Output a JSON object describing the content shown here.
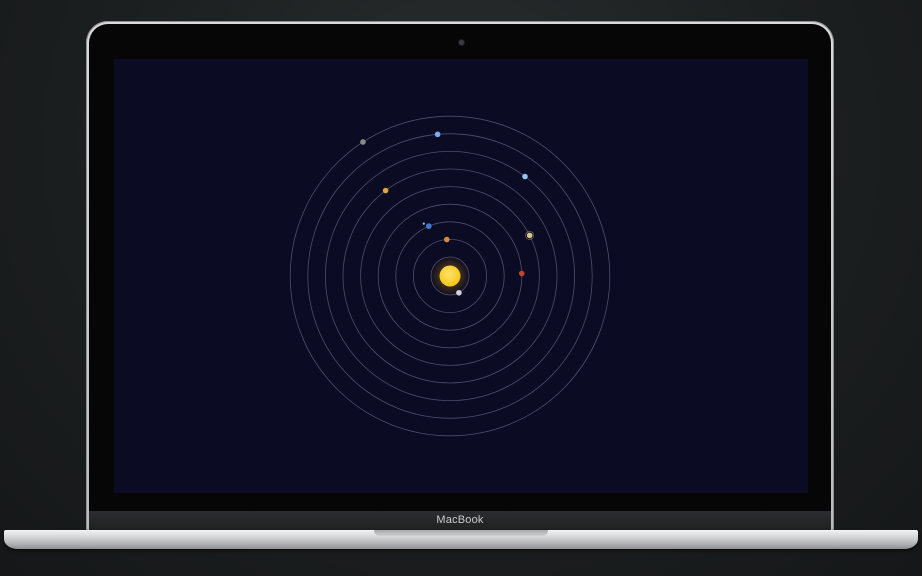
{
  "device": {
    "brand_label": "MacBook"
  },
  "solar_system": {
    "background_color": "#0b0b24",
    "orbit_color": "#5a5b78",
    "sun": {
      "color": "#f5c518",
      "glow": "#7a5a10"
    },
    "planets": [
      {
        "name": "mercury",
        "orbit": 1,
        "angle": 62,
        "color": "#d2d2dc"
      },
      {
        "name": "venus",
        "orbit": 2,
        "angle": 265,
        "color": "#d98a3a"
      },
      {
        "name": "earth",
        "orbit": 3,
        "angle": 247,
        "color": "#3f7ad8"
      },
      {
        "name": "mars",
        "orbit": 4,
        "angle": 358,
        "color": "#c0472c"
      },
      {
        "name": "jupiter",
        "orbit": 5,
        "angle": 333,
        "color": "#d7c890"
      },
      {
        "name": "saturn",
        "orbit": 6,
        "angle": 233,
        "color": "#e0a445"
      },
      {
        "name": "uranus",
        "orbit": 7,
        "angle": 307,
        "color": "#8ec6f0"
      },
      {
        "name": "neptune",
        "orbit": 8,
        "angle": 265,
        "color": "#71aefc"
      },
      {
        "name": "pluto",
        "orbit": 9,
        "angle": 237,
        "color": "#8a8a8a"
      }
    ],
    "moon": {
      "color": "#9fb6e0"
    }
  }
}
